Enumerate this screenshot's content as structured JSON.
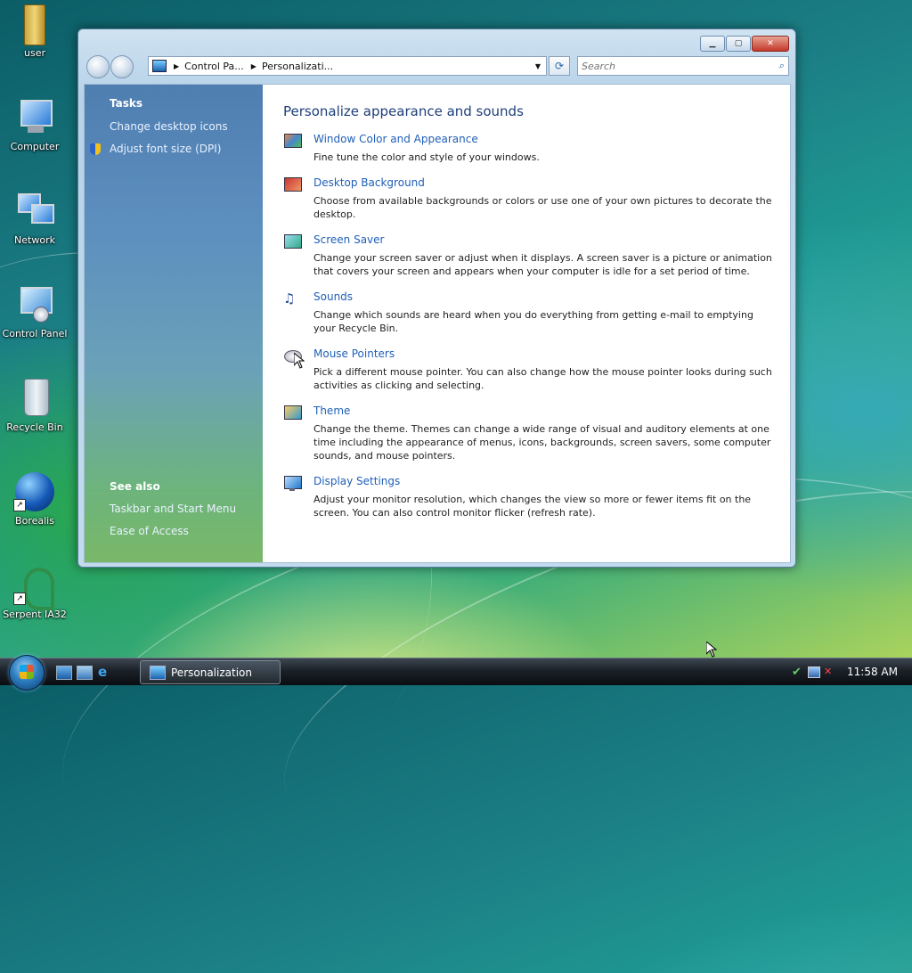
{
  "desktop": {
    "icons": [
      {
        "label": "user",
        "icon": "folder-icon"
      },
      {
        "label": "Computer",
        "icon": "computer-icon"
      },
      {
        "label": "Network",
        "icon": "network-icon"
      },
      {
        "label": "Control Panel",
        "icon": "control-panel-icon"
      },
      {
        "label": "Recycle Bin",
        "icon": "recycle-bin-icon"
      },
      {
        "label": "Borealis",
        "icon": "globe-shortcut-icon"
      },
      {
        "label": "Serpent IA32",
        "icon": "serpent-shortcut-icon"
      }
    ]
  },
  "window": {
    "address": {
      "crumbs": [
        "Control Pa...",
        "Personalizati..."
      ]
    },
    "search_placeholder": "Search",
    "sidebar": {
      "tasks_heading": "Tasks",
      "tasks": [
        "Change desktop icons",
        "Adjust font size (DPI)"
      ],
      "see_also_heading": "See also",
      "see_also": [
        "Taskbar and Start Menu",
        "Ease of Access"
      ]
    },
    "main": {
      "title": "Personalize appearance and sounds",
      "items": [
        {
          "link": "Window Color and Appearance",
          "desc": "Fine tune the color and style of your windows.",
          "icon": "window-color-icon"
        },
        {
          "link": "Desktop Background",
          "desc": "Choose from available backgrounds or colors or use one of your own pictures to decorate the desktop.",
          "icon": "desktop-background-icon"
        },
        {
          "link": "Screen Saver",
          "desc": "Change your screen saver or adjust when it displays. A screen saver is a picture or animation that covers your screen and appears when your computer is idle for a set period of time.",
          "icon": "screen-saver-icon"
        },
        {
          "link": "Sounds",
          "desc": "Change which sounds are heard when you do everything from getting e-mail to emptying your Recycle Bin.",
          "icon": "sounds-icon"
        },
        {
          "link": "Mouse Pointers",
          "desc": "Pick a different mouse pointer. You can also change how the mouse pointer looks during such activities as clicking and selecting.",
          "icon": "mouse-pointers-icon"
        },
        {
          "link": "Theme",
          "desc": "Change the theme. Themes can change a wide range of visual and auditory elements at one time including the appearance of menus, icons, backgrounds, screen savers, some computer sounds, and mouse pointers.",
          "icon": "theme-icon"
        },
        {
          "link": "Display Settings",
          "desc": "Adjust your monitor resolution, which changes the view so more or fewer items fit on the screen. You can also control monitor flicker (refresh rate).",
          "icon": "display-settings-icon"
        }
      ]
    }
  },
  "taskbar": {
    "active_window": "Personalization",
    "clock": "11:58 AM"
  }
}
